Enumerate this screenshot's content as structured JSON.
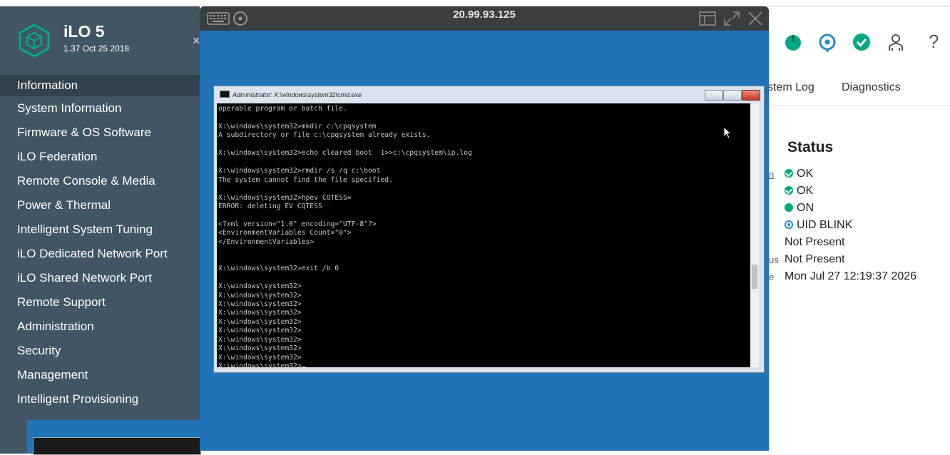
{
  "brand": {
    "title": "iLO 5",
    "version": "1.37 Oct 25 2018"
  },
  "sidebar": {
    "items": [
      {
        "label": "Information",
        "active": true
      },
      {
        "label": "System Information"
      },
      {
        "label": "Firmware & OS Software"
      },
      {
        "label": "iLO Federation"
      },
      {
        "label": "Remote Console & Media"
      },
      {
        "label": "Power & Thermal"
      },
      {
        "label": "Intelligent System Tuning"
      },
      {
        "label": "iLO Dedicated Network Port"
      },
      {
        "label": "iLO Shared Network Port"
      },
      {
        "label": "Remote Support"
      },
      {
        "label": "Administration"
      },
      {
        "label": "Security"
      },
      {
        "label": "Management"
      },
      {
        "label": "Intelligent Provisioning"
      }
    ],
    "collapse": "×"
  },
  "console": {
    "title": "20.99.93.125",
    "cmd_title": "Administrator: X:\\windows\\system32\\cmd.exe",
    "lines": [
      "operable program or batch file.",
      "",
      "X:\\windows\\system32>mkdir c:\\cpqsystem",
      "A subdirectory or file c:\\cpqsystem already exists.",
      "",
      "X:\\windows\\system32>echo cleared boot  1>>c:\\cpqsystem\\ip.log",
      "",
      "X:\\windows\\system32>rmdir /s /q c:\\boot",
      "The system cannot find the file specified.",
      "",
      "X:\\windows\\system32>hpev CQTESS=",
      "ERROR: deleting EV CQTESS",
      "",
      "<?xml version=\"1.0\" encoding=\"UTF-8\"?>",
      "<EnvironmentVariables Count=\"0\">",
      "</EnvironmentVariables>",
      "",
      "",
      "X:\\windows\\system32>exit /b 0",
      "",
      "X:\\windows\\system32>",
      "X:\\windows\\system32>",
      "X:\\windows\\system32>",
      "X:\\windows\\system32>",
      "X:\\windows\\system32>",
      "X:\\windows\\system32>",
      "X:\\windows\\system32>",
      "X:\\windows\\system32>",
      "X:\\windows\\system32>",
      "X:\\windows\\system32>"
    ]
  },
  "right": {
    "tabs": {
      "log": "stem Log",
      "diagnostics": "Diagnostics"
    },
    "status_title": "Status",
    "left_fragments": {
      "link": "n",
      "us": "us",
      "e": "e"
    },
    "rows": [
      {
        "text": "OK",
        "icon": "check-circle-icon"
      },
      {
        "text": "OK",
        "icon": "check-circle-icon"
      },
      {
        "text": "ON",
        "icon": "power-dot-icon"
      },
      {
        "text": "UID BLINK",
        "icon": "uid-icon"
      },
      {
        "text": "Not Present"
      },
      {
        "text": "Not Present"
      },
      {
        "text": "Mon Jul 27 12:19:37 2026"
      }
    ],
    "help": "?"
  },
  "colors": {
    "sidebar": "#425563",
    "accent": "#01a982",
    "console_blue": "#1f73b7"
  }
}
